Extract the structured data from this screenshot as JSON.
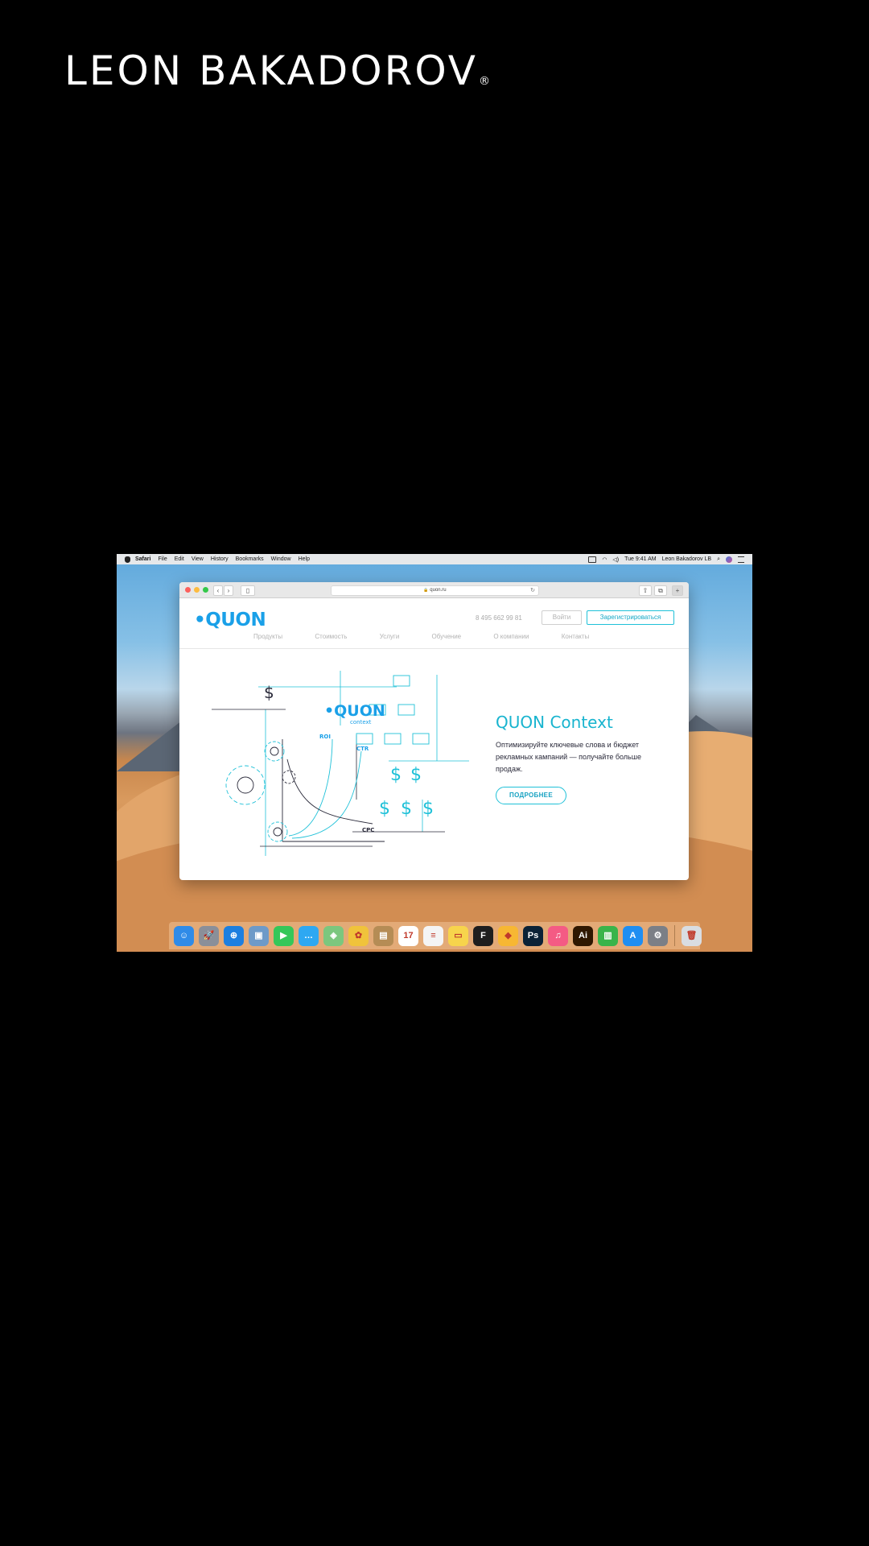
{
  "brand": {
    "name": "LEON BAKADOROV",
    "mark": "®"
  },
  "menubar": {
    "app": "Safari",
    "items": [
      "File",
      "Edit",
      "View",
      "History",
      "Bookmarks",
      "Window",
      "Help"
    ],
    "clock": "Tue 9:41 AM",
    "user": "Leon Bakadorov LB"
  },
  "browser": {
    "url": "quon.ru",
    "lock": "🔒",
    "reload": "↻"
  },
  "site": {
    "logo": "•QUON",
    "phone": "8 495 662 99 81",
    "login_label": "Войти",
    "register_label": "Зарегистрироваться",
    "nav": [
      "Продукты",
      "Стоимость",
      "Услуги",
      "Обучение",
      "О компании",
      "Контакты"
    ],
    "hero": {
      "title": "QUON Context",
      "text": "Оптимизируйте ключевые слова и бюджет рекламных кампаний — получайте больше продаж.",
      "button": "ПОДРОБНЕЕ"
    },
    "illustration": {
      "logo": "•QUON",
      "sublabel": "context",
      "labels": [
        "ROI",
        "CTR",
        "CPC"
      ],
      "dollar": "$"
    }
  },
  "dock": {
    "apps": [
      {
        "name": "finder-icon",
        "glyph": "☺",
        "color": "#2f8be8"
      },
      {
        "name": "launchpad-icon",
        "glyph": "🚀",
        "color": "#8a8f99"
      },
      {
        "name": "safari-icon",
        "glyph": "⊕",
        "color": "#1c7fe0"
      },
      {
        "name": "preview-icon",
        "glyph": "▣",
        "color": "#6d9ac8"
      },
      {
        "name": "facetime-icon",
        "glyph": "▶",
        "color": "#35c759"
      },
      {
        "name": "messages-icon",
        "glyph": "…",
        "color": "#2ea8f2"
      },
      {
        "name": "maps-icon",
        "glyph": "◈",
        "color": "#7bc77e"
      },
      {
        "name": "photos-icon",
        "glyph": "✿",
        "color": "#f0c33b"
      },
      {
        "name": "contacts-icon",
        "glyph": "▤",
        "color": "#b58c55"
      },
      {
        "name": "calendar-icon",
        "glyph": "17",
        "color": "#ffffff"
      },
      {
        "name": "reminders-icon",
        "glyph": "≡",
        "color": "#f4f4f4"
      },
      {
        "name": "notes-icon",
        "glyph": "▭",
        "color": "#f7d44c"
      },
      {
        "name": "figma-icon",
        "glyph": "F",
        "color": "#1e1e1e"
      },
      {
        "name": "sketch-icon",
        "glyph": "◆",
        "color": "#f7b733"
      },
      {
        "name": "photoshop-icon",
        "glyph": "Ps",
        "color": "#0b2236"
      },
      {
        "name": "music-icon",
        "glyph": "♫",
        "color": "#f45b84"
      },
      {
        "name": "illustrator-icon",
        "glyph": "Ai",
        "color": "#2f1700"
      },
      {
        "name": "numbers-icon",
        "glyph": "▥",
        "color": "#39b44a"
      },
      {
        "name": "app-store-icon",
        "glyph": "A",
        "color": "#1f8ef2"
      },
      {
        "name": "system-preferences-icon",
        "glyph": "⚙",
        "color": "#7b7f86"
      }
    ],
    "trash": {
      "name": "trash-icon",
      "glyph": "🗑",
      "color": "#d9dde2"
    }
  }
}
